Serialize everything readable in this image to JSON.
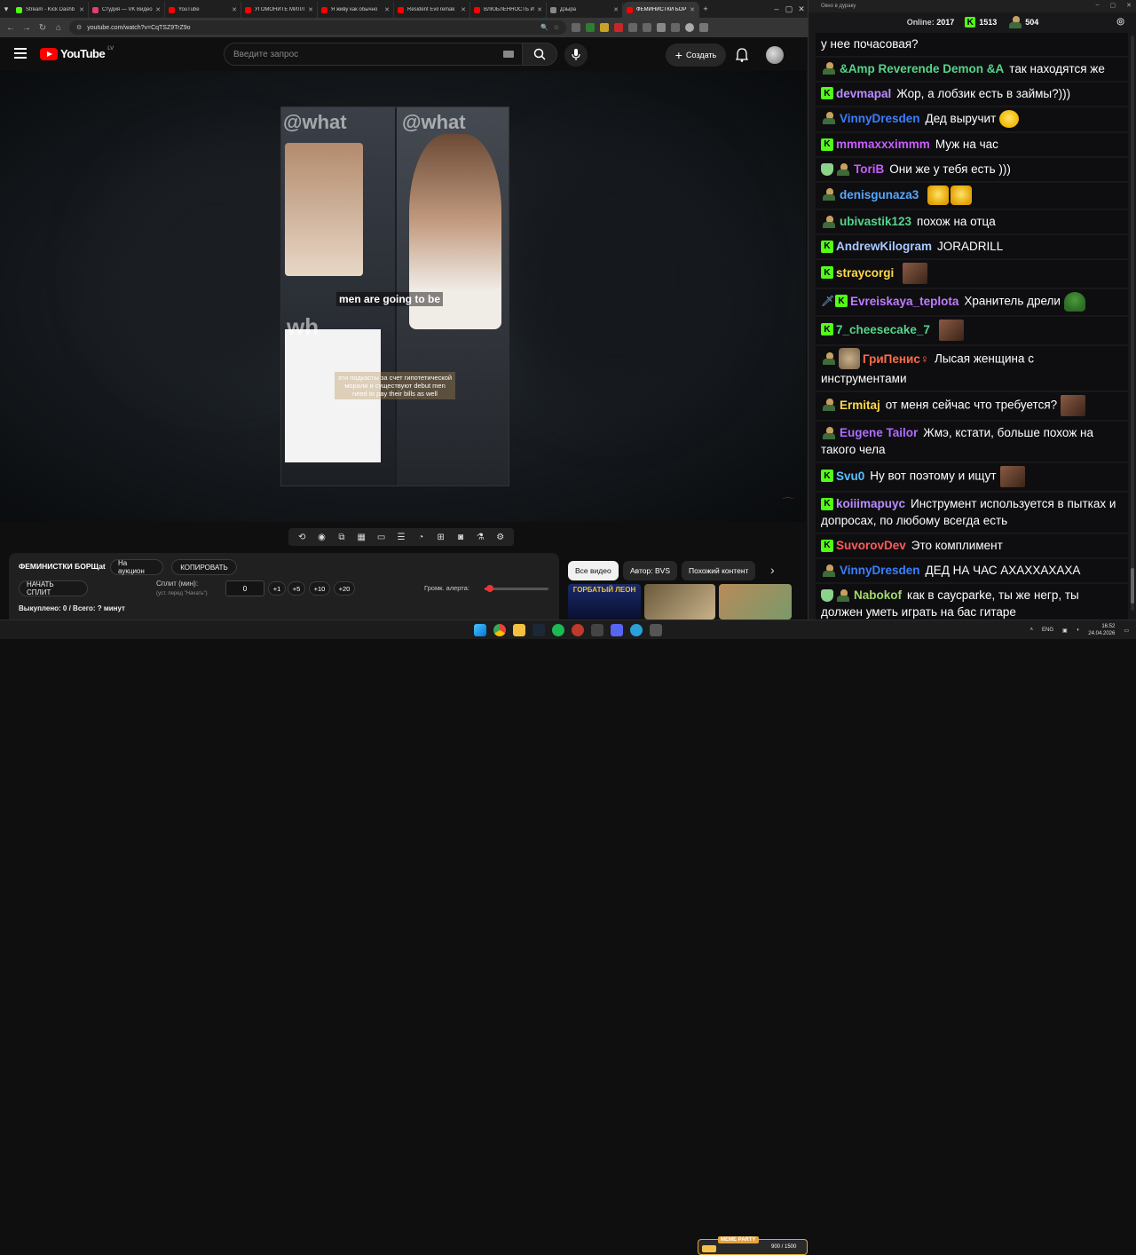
{
  "browser": {
    "tabs": [
      {
        "label": "Stream - Kick Dashb",
        "fav": "#53fc18",
        "active": false
      },
      {
        "label": "Студия — VK Видео",
        "fav": "#e0406a",
        "active": false
      },
      {
        "label": "YouTube",
        "fav": "#ff0000",
        "active": false
      },
      {
        "label": "УГОМОНИТЕ МИЛЛ",
        "fav": "#ff0000",
        "active": false
      },
      {
        "label": "Я живу как обычно",
        "fav": "#ff0000",
        "active": false
      },
      {
        "label": "Resident Evil remak",
        "fav": "#ff0000",
        "active": false
      },
      {
        "label": "ВЛЮБЛЕННОСТЬ И",
        "fav": "#ff0000",
        "active": false
      },
      {
        "label": "Дзыра",
        "fav": "#888888",
        "active": false
      },
      {
        "label": "ФЕМИНИСТКИ БОР",
        "fav": "#ff0000",
        "active": true
      }
    ],
    "new_tab": "+",
    "url": "youtube.com/watch?v=CqTSZ9TrZ9o"
  },
  "youtube": {
    "logo_text": "YouTube",
    "region": "LV",
    "search_placeholder": "Введите запрос",
    "create_label": "Создать"
  },
  "video": {
    "watermark_left": "@what",
    "watermark_right": "@what",
    "watermark_bottom": "wh",
    "caption_en": "men are going to be",
    "caption_ru": "эти подкасты за счет гипотетической морали и существуют debut men need to pay their bills as well",
    "corner_mark": "..—.."
  },
  "extension": {
    "title": "ФЕМИНИСТКИ БОРЩat",
    "auction_label": "На аукцион",
    "copy_label": "КОПИРОВАТЬ",
    "start_split_label": "НАЧАТЬ СПЛИТ",
    "split_label": "Сплит (мин):",
    "split_hint": "(уст. перед \"Начать\")",
    "split_value": "0",
    "increments": [
      "+1",
      "+5",
      "+10",
      "+20"
    ],
    "alert_volume_label": "Громк. алерта:",
    "alert_volume": 0.08,
    "bought_text": "Выкуплено: 0 / Всего: ? минут"
  },
  "related": {
    "chips": [
      "Все видео",
      "Автор: BVS",
      "Похожий контент"
    ],
    "thumb_text": "ГОРБАТЫЙ ЛЕОН"
  },
  "chat": {
    "window_title": "Окно в дураку",
    "online_label": "Online:",
    "online_value": "2017",
    "kick_count": "1513",
    "other_count": "504",
    "messages": [
      {
        "user": "",
        "color": "#ffffff",
        "badges": [],
        "text": "у нее почасовая?",
        "emote": ""
      },
      {
        "user": "&Amp Reverende Demon &A",
        "color": "#56d48a",
        "badges": [
          "guy"
        ],
        "text": "так находятся же",
        "emote": ""
      },
      {
        "user": "devmapal",
        "color": "#b98cff",
        "badges": [
          "kick"
        ],
        "text": "Жор, а лобзик есть в займы?)))",
        "emote": ""
      },
      {
        "user": "VinnyDresden",
        "color": "#3b7fff",
        "badges": [
          "guy"
        ],
        "text": "Дед выручит",
        "emote": "lol"
      },
      {
        "user": "mmmaxxximmm",
        "color": "#c95cff",
        "badges": [
          "kick"
        ],
        "text": "Муж на час",
        "emote": ""
      },
      {
        "user": "ToriB",
        "color": "#c95cff",
        "badges": [
          "shield",
          "guy"
        ],
        "text": "Они же у тебя есть )))",
        "emote": ""
      },
      {
        "user": "denisgunaza3",
        "color": "#58a6ff",
        "badges": [
          "guy"
        ],
        "text": "",
        "emote": "lolbox2"
      },
      {
        "user": "ubivastik123",
        "color": "#56d48a",
        "badges": [
          "guy"
        ],
        "text": "похож на отца",
        "emote": ""
      },
      {
        "user": "AndrewKilogram",
        "color": "#a9c8ff",
        "badges": [
          "kick"
        ],
        "text": "JORADRILL",
        "emote": ""
      },
      {
        "user": "straycorgi",
        "color": "#ffd84a",
        "badges": [
          "kick"
        ],
        "text": "",
        "emote": "face"
      },
      {
        "user": "Evreiskaya_teplota",
        "color": "#c07cff",
        "badges": [
          "sword",
          "kick"
        ],
        "text": "Хранитель дрели",
        "emote": "pepe"
      },
      {
        "user": "7_cheesecake_7",
        "color": "#56d48a",
        "badges": [
          "kick"
        ],
        "text": "",
        "emote": "face"
      },
      {
        "user": "ГриПенис♀",
        "color": "#ff6b4a",
        "badges": [
          "guy",
          "cat"
        ],
        "text": "Лысая женщина с инструментами",
        "emote": ""
      },
      {
        "user": "Ermitaj",
        "color": "#ffd84a",
        "badges": [
          "guy"
        ],
        "text": "от меня сейчас что требуется?",
        "emote": "face"
      },
      {
        "user": "Eugene Tailor",
        "color": "#b06cff",
        "badges": [
          "guy"
        ],
        "text": "Жмэ, кстати, больше похож на такого чела",
        "emote": ""
      },
      {
        "user": "Svu0",
        "color": "#58c0ff",
        "badges": [
          "kick"
        ],
        "text": "Ну вот поэтому и ищут",
        "emote": "face"
      },
      {
        "user": "koiiimapuyc",
        "color": "#b98cff",
        "badges": [
          "kick"
        ],
        "text": "Инструмент используется в пытках и допросах, по любому всегда есть",
        "emote": ""
      },
      {
        "user": "SuvorovDev",
        "color": "#ff5a5a",
        "badges": [
          "kick"
        ],
        "text": "Это комплимент",
        "emote": ""
      },
      {
        "user": "VinnyDresden",
        "color": "#3b7fff",
        "badges": [
          "guy"
        ],
        "text": "ДЕД НА ЧАС АХАХХАХАХА",
        "emote": ""
      },
      {
        "user": "Nabokof",
        "color": "#a4d86a",
        "badges": [
          "shield",
          "guy"
        ],
        "text": "как в саусparke, ты же негр, ты должен уметь играть на бас гитаре",
        "emote": ""
      }
    ]
  },
  "taskbar": {
    "meme_title": "MEME PARTY",
    "meme_count": "900 / 1500",
    "lang": "ENG",
    "time": "16:52",
    "date": "24.04.2026"
  }
}
